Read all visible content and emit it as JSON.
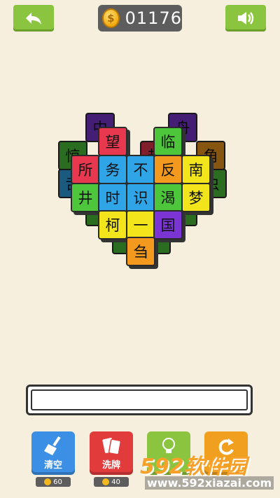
{
  "header": {
    "coins": "01176",
    "coin_symbol": "$"
  },
  "board": {
    "back_tiles": [
      "中",
      "舟",
      "惊",
      "角",
      "舌",
      "劫",
      "虫"
    ],
    "front_tiles": [
      "望",
      "临",
      "所",
      "务",
      "不",
      "反",
      "南",
      "井",
      "时",
      "识",
      "渴",
      "梦",
      "柯",
      "一",
      "国",
      "刍"
    ]
  },
  "colors": {
    "red": "#e8384f",
    "blue": "#2fa4e7",
    "orange": "#f39a1e",
    "green": "#4ec63b",
    "yellow": "#f2e51c",
    "purple": "#7b35d4",
    "button_green": "#8bc53f"
  },
  "tools": [
    {
      "label": "清空",
      "cost": "60",
      "color": "#3b8fe4",
      "icon": "broom-icon"
    },
    {
      "label": "洗牌",
      "cost": "40",
      "color": "#e23b3b",
      "icon": "cards-icon"
    },
    {
      "label": "",
      "cost": "",
      "color": "#8bc53f",
      "icon": "lightbulb-icon"
    },
    {
      "label": "",
      "cost": "",
      "color": "#f0a01e",
      "icon": "undo-icon"
    }
  ],
  "watermark": {
    "text": "592软件园",
    "url": "www.592xiazai.com"
  }
}
